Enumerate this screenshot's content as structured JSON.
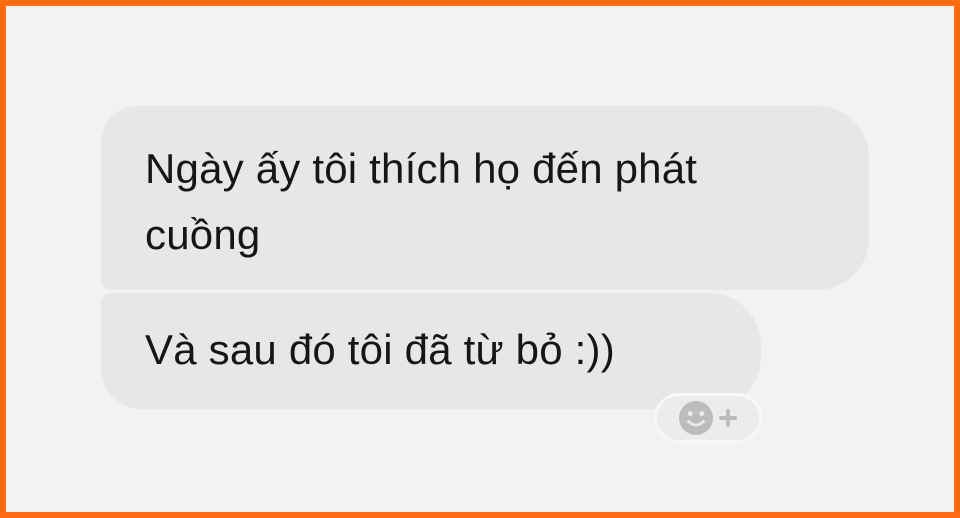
{
  "colors": {
    "frame_border": "#ff6a13",
    "background": "#f2f2f2",
    "bubble": "#e7e7e7",
    "reaction_icon": "#bcbcbc"
  },
  "messages": [
    {
      "lines": [
        "Ngày ấy tôi thích họ đến phát",
        "cuồng"
      ]
    },
    {
      "lines": [
        "Và sau đó tôi đã từ bỏ :))"
      ]
    }
  ],
  "reaction_button": {
    "icons": [
      "smiley-face-icon",
      "plus-icon"
    ]
  }
}
